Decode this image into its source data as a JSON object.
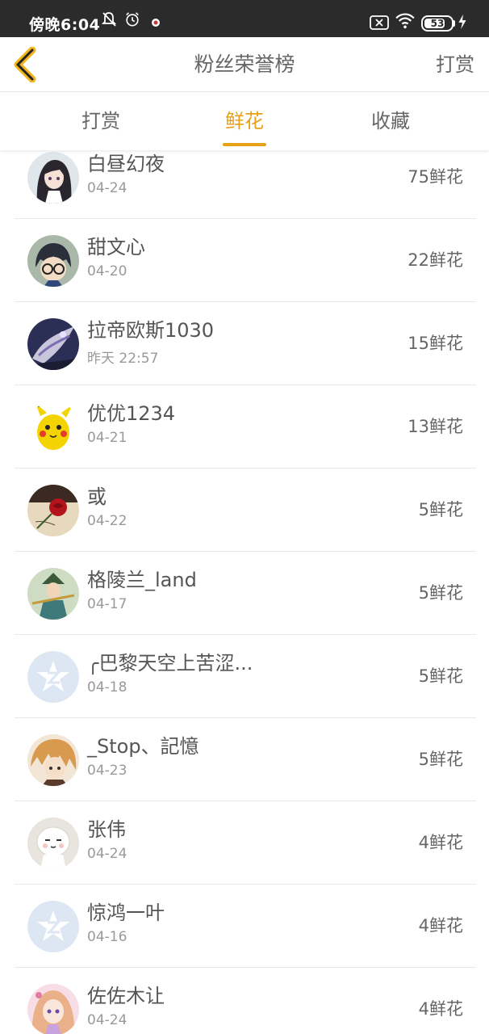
{
  "status_bar": {
    "time": "傍晚6:04",
    "battery_level": "53",
    "icons": [
      "mute-bell-icon",
      "alarm-icon",
      "notification-icon",
      "sim-x-icon",
      "wifi-icon",
      "battery-icon",
      "charging-icon"
    ]
  },
  "header": {
    "title": "粉丝荣誉榜",
    "right_action": "打赏",
    "back_icon": "chevron-left-icon"
  },
  "tabs": [
    {
      "label": "打赏",
      "active": false
    },
    {
      "label": "鲜花",
      "active": true
    },
    {
      "label": "收藏",
      "active": false
    }
  ],
  "colors": {
    "accent": "#e6a117",
    "status_bar": "#2b2b2b",
    "default_avatar": "#dde7f3"
  },
  "fans": [
    {
      "name": "白昼幻夜",
      "date": "04-24",
      "amount": "75鲜花",
      "avatar": "anime-girl"
    },
    {
      "name": "甜文心",
      "date": "04-20",
      "amount": "22鲜花",
      "avatar": "detective"
    },
    {
      "name": "拉帝欧斯1030",
      "date": "昨天 22:57",
      "amount": "15鲜花",
      "avatar": "dragon"
    },
    {
      "name": "优优1234",
      "date": "04-21",
      "amount": "13鲜花",
      "avatar": "pikachu"
    },
    {
      "name": "或",
      "date": "04-22",
      "amount": "5鲜花",
      "avatar": "rose"
    },
    {
      "name": "格陵兰_land",
      "date": "04-17",
      "amount": "5鲜花",
      "avatar": "warrior"
    },
    {
      "name": "╭巴黎天空上苦涩...",
      "date": "04-18",
      "amount": "5鲜花",
      "avatar": "default"
    },
    {
      "name": "_Stop、記憶",
      "date": "04-23",
      "amount": "5鲜花",
      "avatar": "anime-boy"
    },
    {
      "name": "张伟",
      "date": "04-24",
      "amount": "4鲜花",
      "avatar": "tuzki"
    },
    {
      "name": "惊鸿一叶",
      "date": "04-16",
      "amount": "4鲜花",
      "avatar": "default"
    },
    {
      "name": "佐佐木让",
      "date": "04-24",
      "amount": "4鲜花",
      "avatar": "pink-girl"
    }
  ]
}
